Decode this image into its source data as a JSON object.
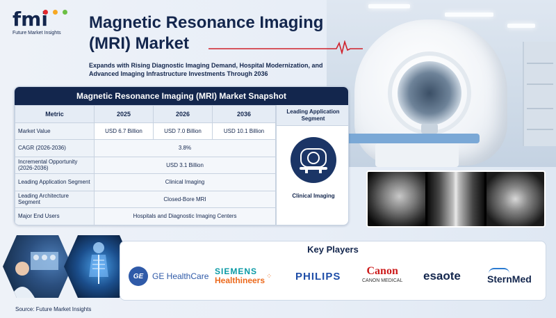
{
  "logo": {
    "mark": "fmi",
    "tagline": "Future Market Insights",
    "dot_colors": [
      "#e2272c",
      "#f7a823",
      "#6bbf44"
    ]
  },
  "header": {
    "title": "Magnetic Resonance Imaging (MRI) Market",
    "subtitle": "Expands with Rising Diagnostic Imaging Demand, Hospital Modernization, and Advanced Imaging Infrastructure Investments Through 2036"
  },
  "snapshot": {
    "title": "Magnetic Resonance Imaging (MRI) Market Snapshot",
    "columns": [
      "Metric",
      "2025",
      "2026",
      "2036"
    ],
    "rows": [
      {
        "label": "Market Value",
        "values": [
          "USD 6.7 Billion",
          "USD 7.0 Billion",
          "USD 10.1 Billion"
        ]
      },
      {
        "label": "CAGR (2026-2036)",
        "span": "3.8%"
      },
      {
        "label": "Incremental Opportunity (2026-2036)",
        "span": "USD 3.1 Billion"
      },
      {
        "label": "Leading Application Segment",
        "span": "Clinical Imaging"
      },
      {
        "label": "Leading Architecture Segment",
        "span": "Closed-Bore MRI"
      },
      {
        "label": "Major End Users",
        "span": "Hospitals and Diagnostic Imaging Centers"
      }
    ],
    "segment": {
      "heading": "Leading Application Segment",
      "label": "Clinical Imaging",
      "icon": "mri-scanner-icon"
    }
  },
  "key_players": {
    "title": "Key Players",
    "ge": {
      "mark": "GE",
      "name": "GE HealthCare"
    },
    "siemens": {
      "line1": "SIEMENS",
      "line2": "Healthineers"
    },
    "philips": "PHILIPS",
    "canon": {
      "line1": "Canon",
      "line2": "CANON MEDICAL"
    },
    "esaote": "esaote",
    "sternmed": "SternMed"
  },
  "source": "Source: Future Market Insights",
  "colors": {
    "navy": "#13264d",
    "ge_blue": "#2f5aa8",
    "siemens_teal": "#0a9aa5",
    "siemens_orange": "#ec6a1d",
    "canon_red": "#cc1b1b",
    "pulse_red": "#d0202a"
  }
}
